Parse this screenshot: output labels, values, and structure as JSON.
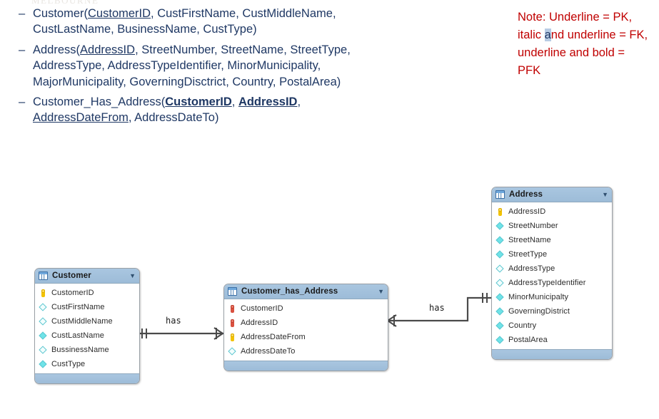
{
  "watermark": "MELBOURNE",
  "schema": {
    "dash": "–",
    "relations": [
      {
        "name": "Customer",
        "segments": [
          {
            "text": "Customer(",
            "style": "plain"
          },
          {
            "text": "CustomerID",
            "style": "pk"
          },
          {
            "text": ", CustFirstName, CustMiddleName, CustLastName, BusinessName, CustType)",
            "style": "plain"
          }
        ]
      },
      {
        "name": "Address",
        "segments": [
          {
            "text": "Address(",
            "style": "plain"
          },
          {
            "text": "AddressID",
            "style": "pk"
          },
          {
            "text": ", StreetNumber, StreetName, StreetType, AddressType, AddressTypeIdentifier, MinorMunicipality, MajorMunicipality, GoverningDisctrict, Country, PostalArea)",
            "style": "plain"
          }
        ]
      },
      {
        "name": "Customer_Has_Address",
        "segments": [
          {
            "text": "Customer_Has_Address(",
            "style": "plain"
          },
          {
            "text": "CustomerID",
            "style": "pfk"
          },
          {
            "text": ", ",
            "style": "plain"
          },
          {
            "text": "AddressID",
            "style": "pfk"
          },
          {
            "text": ", ",
            "style": "plain"
          },
          {
            "text": "AddressDateFrom",
            "style": "pk"
          },
          {
            "text": ", AddressDateTo)",
            "style": "plain"
          }
        ]
      }
    ]
  },
  "note": {
    "line1_a": "Note: Underline = PK, italic ",
    "line1_hl": "a",
    "line1_b": "nd underline = FK, underline and bold = PFK",
    "color": "#c00000",
    "highlight_color": "#b8cce4"
  },
  "diagram": {
    "caret": "▼",
    "entities": [
      {
        "id": "customer",
        "title": "Customer",
        "table_icon": "table-icon",
        "fields": [
          {
            "label": "CustomerID",
            "icon": "key-pk-yellow"
          },
          {
            "label": "CustFirstName",
            "icon": "diamond-hollow"
          },
          {
            "label": "CustMiddleName",
            "icon": "diamond-hollow"
          },
          {
            "label": "CustLastName",
            "icon": "diamond-filled"
          },
          {
            "label": "BussinessName",
            "icon": "diamond-hollow"
          },
          {
            "label": "CustType",
            "icon": "diamond-filled"
          }
        ]
      },
      {
        "id": "customer_has_address",
        "title": "Customer_has_Address",
        "table_icon": "table-icon",
        "fields": [
          {
            "label": "CustomerID",
            "icon": "key-fk-red"
          },
          {
            "label": "AddressID",
            "icon": "key-fk-red"
          },
          {
            "label": "AddressDateFrom",
            "icon": "key-pk-yellow"
          },
          {
            "label": "AddressDateTo",
            "icon": "diamond-hollow"
          }
        ]
      },
      {
        "id": "address",
        "title": "Address",
        "table_icon": "table-icon",
        "fields": [
          {
            "label": "AddressID",
            "icon": "key-pk-yellow"
          },
          {
            "label": "StreetNumber",
            "icon": "diamond-filled"
          },
          {
            "label": "StreetName",
            "icon": "diamond-filled"
          },
          {
            "label": "StreetType",
            "icon": "diamond-filled"
          },
          {
            "label": "AddressType",
            "icon": "diamond-hollow"
          },
          {
            "label": "AddressTypeIdentifier",
            "icon": "diamond-hollow"
          },
          {
            "label": "MinorMunicipalty",
            "icon": "diamond-filled"
          },
          {
            "label": "GoverningDistrict",
            "icon": "diamond-filled"
          },
          {
            "label": "Country",
            "icon": "diamond-filled"
          },
          {
            "label": "PostalArea",
            "icon": "diamond-filled"
          }
        ]
      }
    ],
    "relationships": [
      {
        "id": "rel-customer-has",
        "label": "has"
      },
      {
        "id": "rel-address-has",
        "label": "has"
      }
    ]
  }
}
